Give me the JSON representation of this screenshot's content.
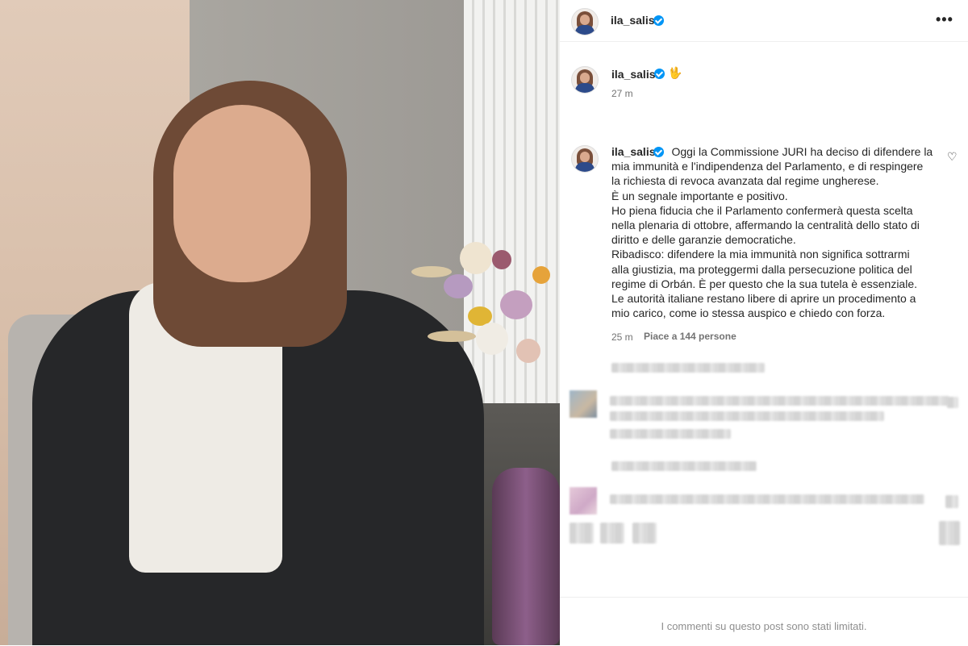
{
  "header": {
    "username": "ila_salis",
    "more_label": "•••"
  },
  "first_comment": {
    "username": "ila_salis",
    "emoji": "🖖",
    "time": "27 m"
  },
  "caption": {
    "username": "ila_salis",
    "lines": [
      "Oggi la Commissione JURI ha deciso di difendere la",
      "mia immunità e l'indipendenza del Parlamento, e di respingere",
      "la richiesta di revoca avanzata dal regime ungherese.",
      "È un segnale importante e positivo.",
      "Ho piena fiducia che il Parlamento confermerà questa scelta",
      "nella plenaria di ottobre, affermando la centralità dello stato di",
      "diritto e delle garanzie democratiche.",
      "Ribadisco: difendere la mia immunità non significa sottrarmi",
      "alla giustizia, ma proteggermi dalla persecuzione politica del",
      "regime di Orbán. È per questo che la sua tutela è essenziale.",
      "Le autorità italiane restano libere di aprire un procedimento a",
      "mio carico, come io stessa auspico e chiedo con forza."
    ],
    "time": "25 m",
    "likes": "Piace a 144 persone"
  },
  "footer": {
    "notice": "I commenti su questo post sono stati limitati."
  },
  "colors": {
    "verified": "#0095f6",
    "text": "#262626",
    "muted": "#737373"
  },
  "icons": {
    "verified": "verified-badge-icon",
    "more": "more-options-icon",
    "like": "heart-outline-icon"
  }
}
